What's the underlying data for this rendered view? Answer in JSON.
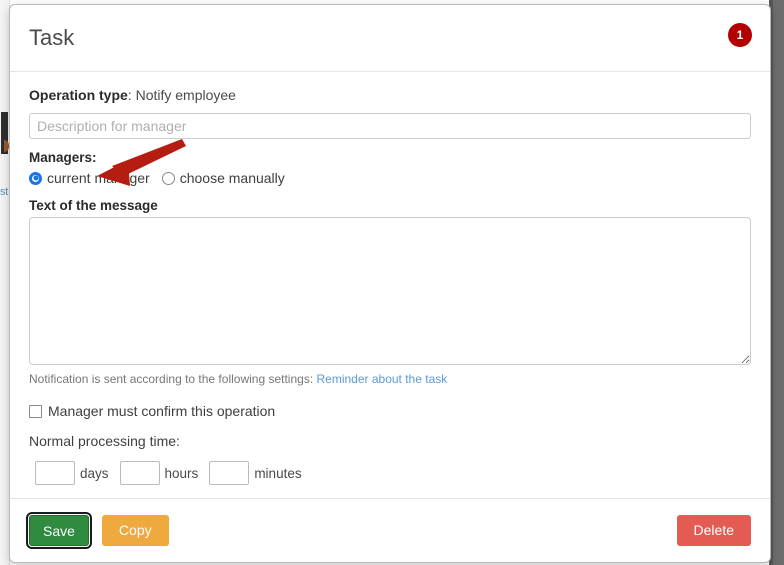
{
  "dialog": {
    "title": "Task",
    "badge_count": "1",
    "operation": {
      "label": "Operation type",
      "separator": ": ",
      "value": "Notify employee"
    },
    "description_input": {
      "value": "",
      "placeholder": "Description for manager"
    },
    "managers": {
      "label": "Managers:",
      "options": [
        {
          "label": "current manager",
          "selected": true
        },
        {
          "label": "choose manually",
          "selected": false
        }
      ]
    },
    "message": {
      "label": "Text of the message",
      "value": "",
      "placeholder": ""
    },
    "notification_note": {
      "text": "Notification is sent according to the following settings:",
      "link_text": "Reminder about the task"
    },
    "confirm_checkbox": {
      "label": "Manager must confirm this operation",
      "checked": false
    },
    "processing_time": {
      "label": "Normal processing time:",
      "fields": [
        {
          "value": "",
          "unit": "days"
        },
        {
          "value": "",
          "unit": "hours"
        },
        {
          "value": "",
          "unit": "minutes"
        }
      ]
    },
    "footer": {
      "save_label": "Save",
      "copy_label": "Copy",
      "delete_label": "Delete"
    }
  },
  "background": {
    "fragment_text": "st"
  },
  "colors": {
    "badge": "#b30000",
    "save": "#2e8b40",
    "copy": "#efa93f",
    "delete": "#e35b53",
    "link": "#5b9bd5",
    "radio_selected": "#1a73e8",
    "annotation_arrow": "#b51d12"
  }
}
